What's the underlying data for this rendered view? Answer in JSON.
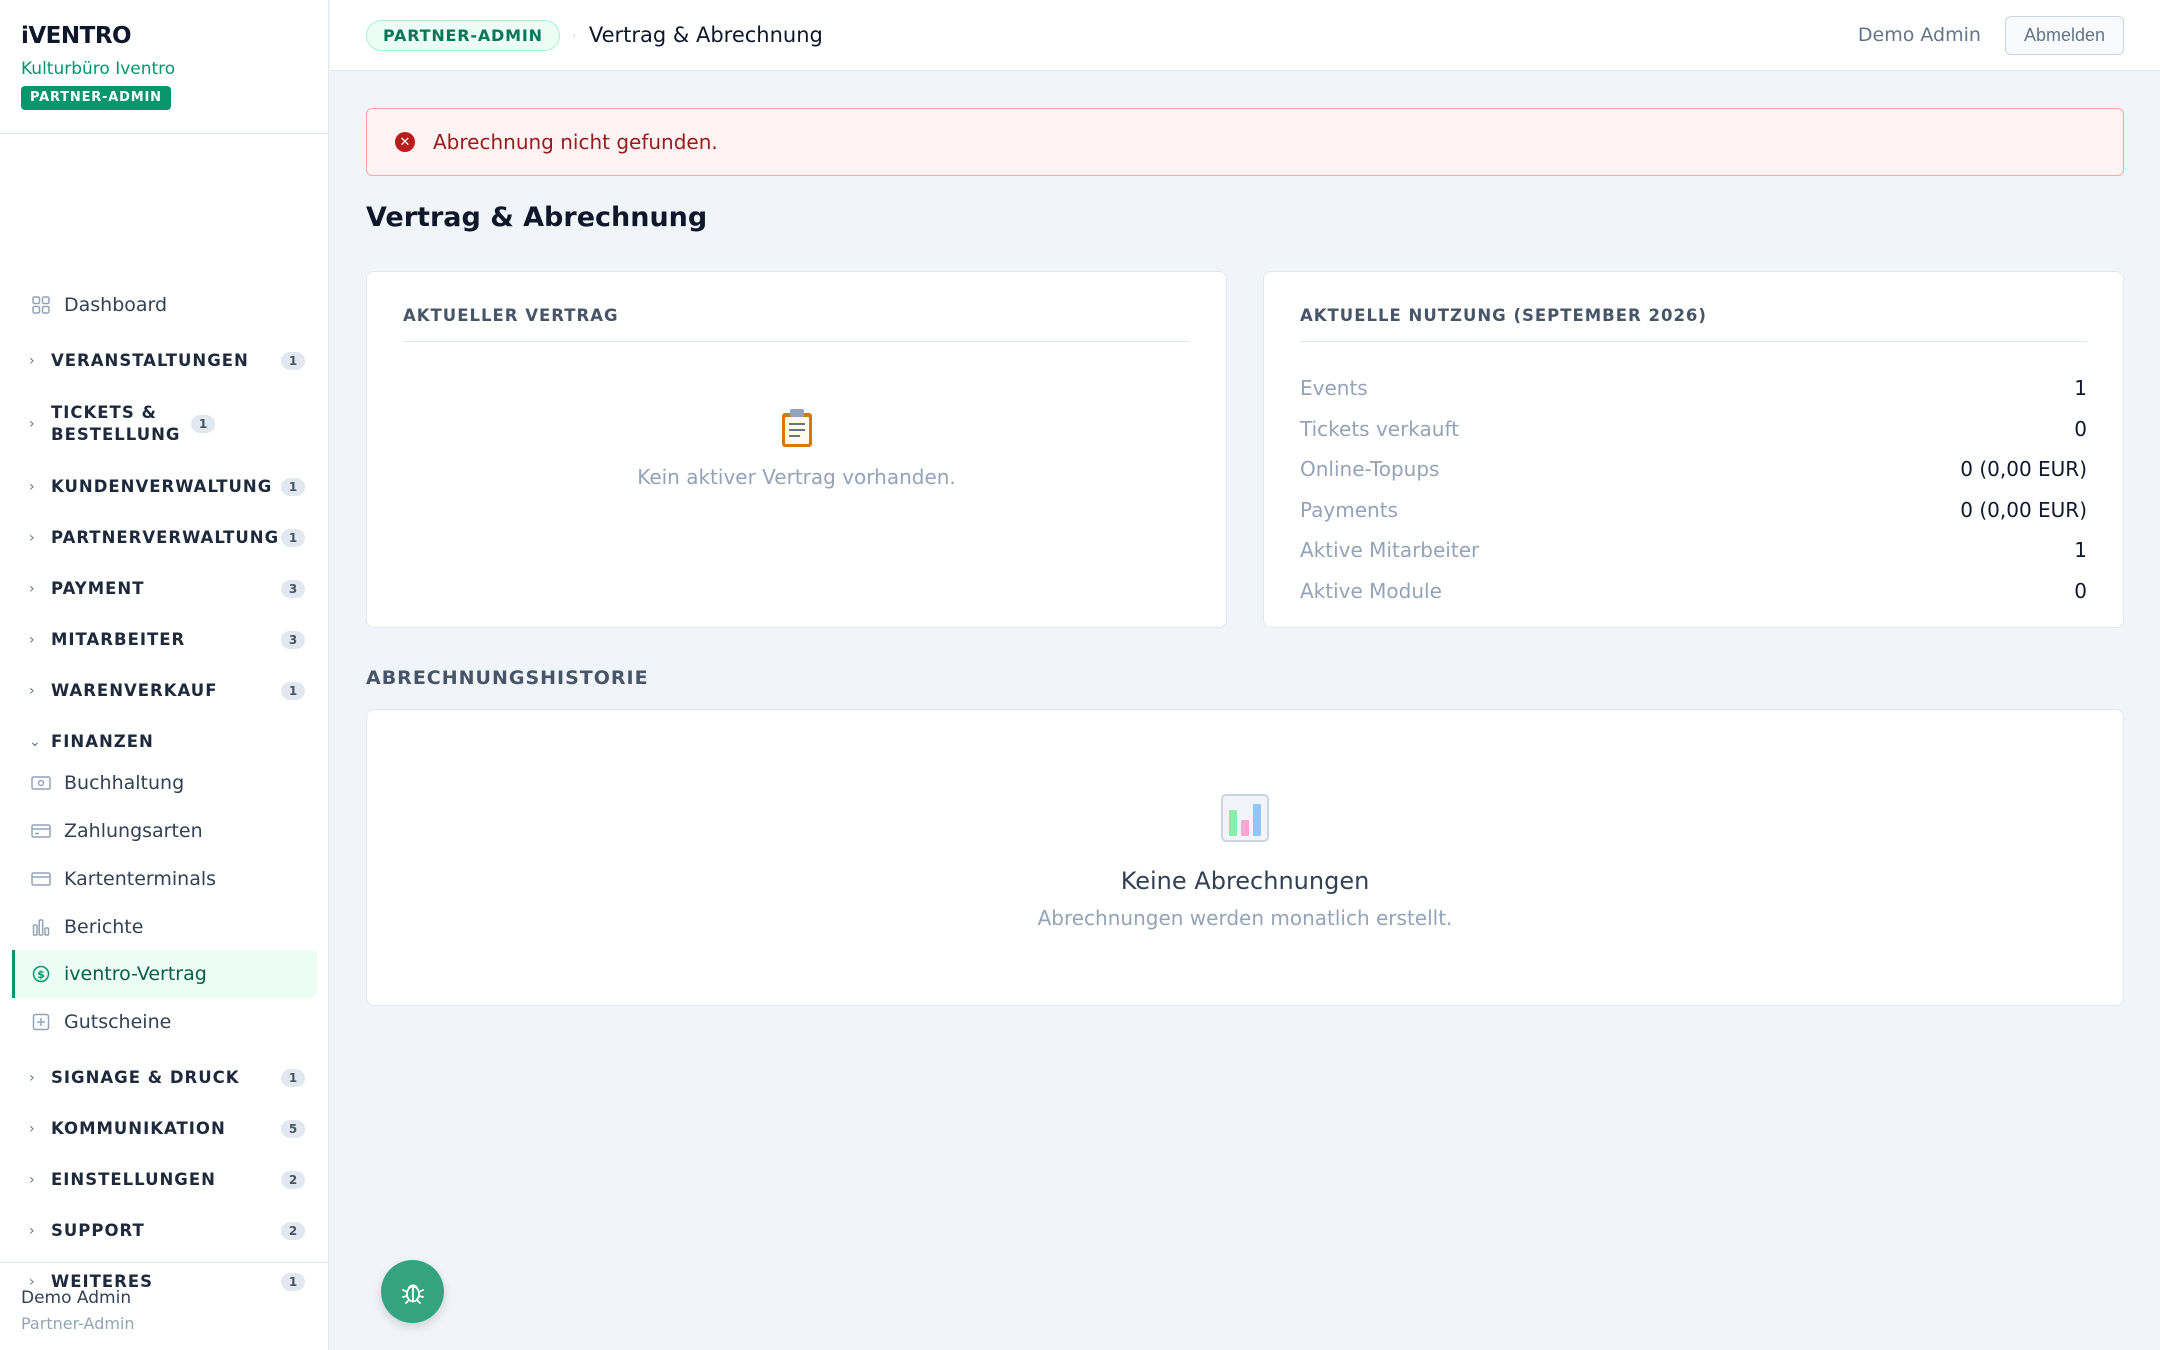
{
  "brand": {
    "logo": "iVENTRO",
    "organization": "Kulturbüro Iventro",
    "role_badge": "PARTNER-ADMIN"
  },
  "sidebar": {
    "dashboard": {
      "label": "Dashboard",
      "icon": "grid-icon"
    },
    "groups_top": [
      {
        "label": "VERANSTALTUNGEN",
        "count": "1"
      },
      {
        "label": "TICKETS & BESTELLUNG",
        "count": "1"
      },
      {
        "label": "KUNDENVERWALTUNG",
        "count": "1"
      },
      {
        "label": "PARTNERVERWALTUNG",
        "count": "1"
      },
      {
        "label": "PAYMENT",
        "count": "3"
      },
      {
        "label": "MITARBEITER",
        "count": "3"
      },
      {
        "label": "WARENVERKAUF",
        "count": "1"
      }
    ],
    "finance": {
      "label": "FINANZEN",
      "items": [
        {
          "label": "Buchhaltung",
          "icon": "cash-icon"
        },
        {
          "label": "Zahlungsarten",
          "icon": "credit-card-icon"
        },
        {
          "label": "Kartenterminals",
          "icon": "card-terminal-icon"
        },
        {
          "label": "Berichte",
          "icon": "bar-chart-icon"
        },
        {
          "label": "iventro-Vertrag",
          "icon": "dollar-circle-icon",
          "active": true
        },
        {
          "label": "Gutscheine",
          "icon": "gift-icon"
        }
      ]
    },
    "groups_bottom": [
      {
        "label": "SIGNAGE & DRUCK",
        "count": "1"
      },
      {
        "label": "KOMMUNIKATION",
        "count": "5"
      },
      {
        "label": "EINSTELLUNGEN",
        "count": "2"
      },
      {
        "label": "SUPPORT",
        "count": "2"
      },
      {
        "label": "WEITERES",
        "count": "1"
      }
    ],
    "footer": {
      "name": "Demo Admin",
      "role": "Partner-Admin"
    }
  },
  "topbar": {
    "badge": "PARTNER-ADMIN",
    "separator": "·",
    "title": "Vertrag & Abrechnung",
    "user": "Demo Admin",
    "logout": "Abmelden"
  },
  "alert": {
    "icon": "error-circle-icon",
    "message": "Abrechnung nicht gefunden."
  },
  "page": {
    "title": "Vertrag & Abrechnung"
  },
  "contract_card": {
    "heading": "AKTUELLER VERTRAG",
    "empty_icon": "clipboard-icon",
    "empty_text": "Kein aktiver Vertrag vorhanden."
  },
  "usage_card": {
    "heading": "AKTUELLE NUTZUNG (SEPTEMBER 2026)",
    "rows": [
      {
        "label": "Events",
        "value": "1"
      },
      {
        "label": "Tickets verkauft",
        "value": "0"
      },
      {
        "label": "Online-Topups",
        "value": "0 (0,00 EUR)"
      },
      {
        "label": "Payments",
        "value": "0 (0,00 EUR)"
      },
      {
        "label": "Aktive Mitarbeiter",
        "value": "1"
      },
      {
        "label": "Aktive Module",
        "value": "0"
      }
    ]
  },
  "history": {
    "section_title": "ABRECHNUNGSHISTORIE",
    "empty_icon": "bar-chart-emoji-icon",
    "empty_title": "Keine Abrechnungen",
    "empty_text": "Abrechnungen werden monatlich erstellt."
  },
  "fab": {
    "icon": "bug-icon"
  },
  "colors": {
    "accent": "#059669",
    "alert_bg": "#fef2f2",
    "alert_text": "#991b1b",
    "page_bg": "#f1f5f9"
  }
}
